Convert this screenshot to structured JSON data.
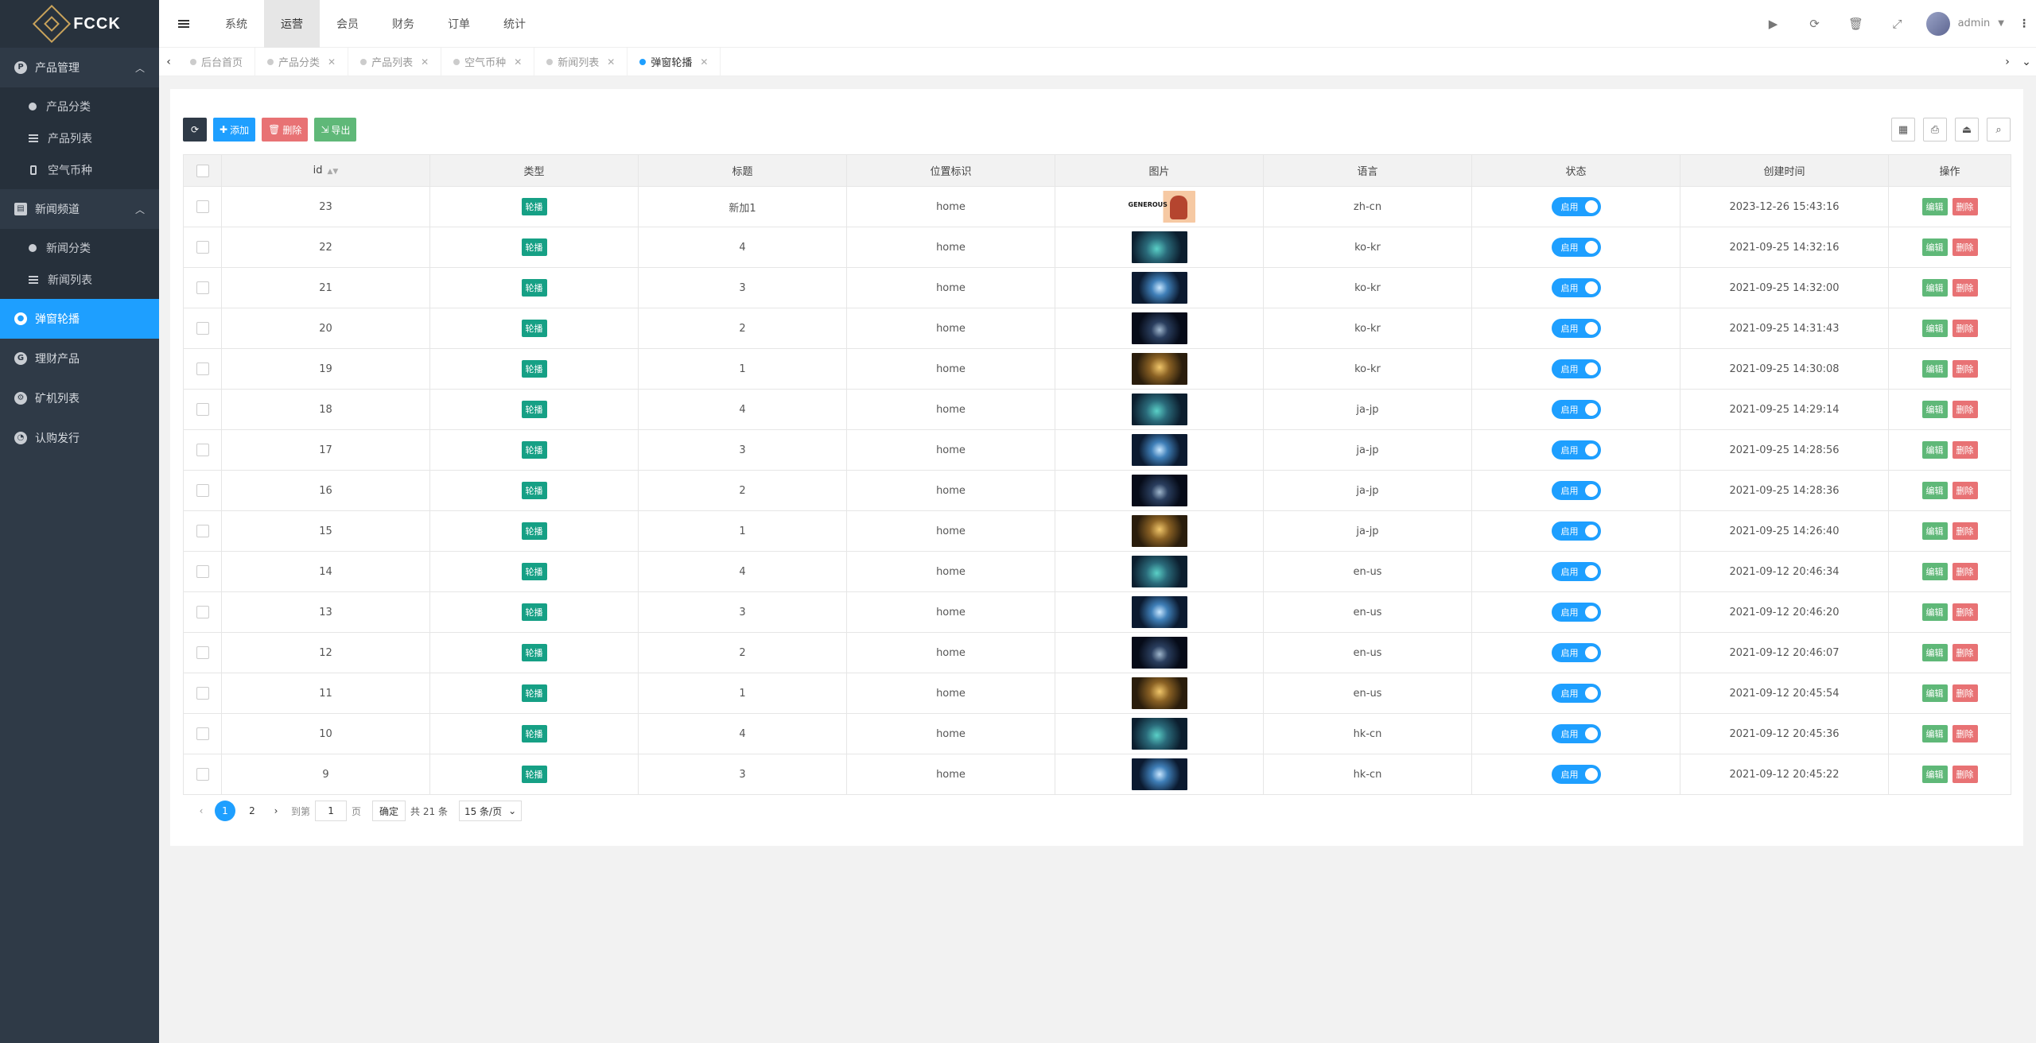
{
  "brand": {
    "name": "FCCK"
  },
  "sidebar": {
    "groups": [
      {
        "label": "产品管理",
        "icon": "product-icon",
        "items": [
          {
            "label": "产品分类"
          },
          {
            "label": "产品列表"
          },
          {
            "label": "空气币种"
          }
        ]
      },
      {
        "label": "新闻频道",
        "icon": "news-icon",
        "items": [
          {
            "label": "新闻分类"
          },
          {
            "label": "新闻列表"
          }
        ]
      }
    ],
    "single": [
      {
        "label": "弹窗轮播",
        "active": true
      },
      {
        "label": "理财产品"
      },
      {
        "label": "矿机列表"
      },
      {
        "label": "认购发行"
      }
    ]
  },
  "header": {
    "nav": [
      "系统",
      "运营",
      "会员",
      "财务",
      "订单",
      "统计"
    ],
    "active_nav": "运营",
    "user": "admin"
  },
  "tabs": [
    "后台首页",
    "产品分类",
    "产品列表",
    "空气币种",
    "新闻列表",
    "弹窗轮播"
  ],
  "active_tab": "弹窗轮播",
  "toolbar": {
    "add": "添加",
    "delete": "删除",
    "export": "导出"
  },
  "table": {
    "columns": [
      "id",
      "类型",
      "标题",
      "位置标识",
      "图片",
      "语言",
      "状态",
      "创建时间",
      "操作"
    ],
    "type_label": "轮播",
    "status_label": "启用",
    "edit_label": "编辑",
    "delete_label": "删除",
    "rows": [
      {
        "id": "23",
        "title": "新加1",
        "position": "home",
        "image": "generous",
        "lang": "zh-cn",
        "created": "2023-12-26 15:43:16"
      },
      {
        "id": "22",
        "title": "4",
        "position": "home",
        "image": "a",
        "lang": "ko-kr",
        "created": "2021-09-25 14:32:16"
      },
      {
        "id": "21",
        "title": "3",
        "position": "home",
        "image": "b",
        "lang": "ko-kr",
        "created": "2021-09-25 14:32:00"
      },
      {
        "id": "20",
        "title": "2",
        "position": "home",
        "image": "c",
        "lang": "ko-kr",
        "created": "2021-09-25 14:31:43"
      },
      {
        "id": "19",
        "title": "1",
        "position": "home",
        "image": "d",
        "lang": "ko-kr",
        "created": "2021-09-25 14:30:08"
      },
      {
        "id": "18",
        "title": "4",
        "position": "home",
        "image": "a",
        "lang": "ja-jp",
        "created": "2021-09-25 14:29:14"
      },
      {
        "id": "17",
        "title": "3",
        "position": "home",
        "image": "b",
        "lang": "ja-jp",
        "created": "2021-09-25 14:28:56"
      },
      {
        "id": "16",
        "title": "2",
        "position": "home",
        "image": "c",
        "lang": "ja-jp",
        "created": "2021-09-25 14:28:36"
      },
      {
        "id": "15",
        "title": "1",
        "position": "home",
        "image": "d",
        "lang": "ja-jp",
        "created": "2021-09-25 14:26:40"
      },
      {
        "id": "14",
        "title": "4",
        "position": "home",
        "image": "a",
        "lang": "en-us",
        "created": "2021-09-12 20:46:34"
      },
      {
        "id": "13",
        "title": "3",
        "position": "home",
        "image": "b",
        "lang": "en-us",
        "created": "2021-09-12 20:46:20"
      },
      {
        "id": "12",
        "title": "2",
        "position": "home",
        "image": "c",
        "lang": "en-us",
        "created": "2021-09-12 20:46:07"
      },
      {
        "id": "11",
        "title": "1",
        "position": "home",
        "image": "d",
        "lang": "en-us",
        "created": "2021-09-12 20:45:54"
      },
      {
        "id": "10",
        "title": "4",
        "position": "home",
        "image": "a",
        "lang": "hk-cn",
        "created": "2021-09-12 20:45:36"
      },
      {
        "id": "9",
        "title": "3",
        "position": "home",
        "image": "b",
        "lang": "hk-cn",
        "created": "2021-09-12 20:45:22"
      }
    ]
  },
  "pager": {
    "pages": [
      "1",
      "2"
    ],
    "current": "1",
    "goto_prefix": "到第",
    "goto_value": "1",
    "goto_suffix": "页",
    "confirm": "确定",
    "total": "共 21 条",
    "page_size": "15 条/页"
  },
  "colors": {
    "accent": "#1e9fff",
    "sidebar": "#2f3a47",
    "badge": "#16a085",
    "danger": "#e87274",
    "success": "#5fb878"
  }
}
